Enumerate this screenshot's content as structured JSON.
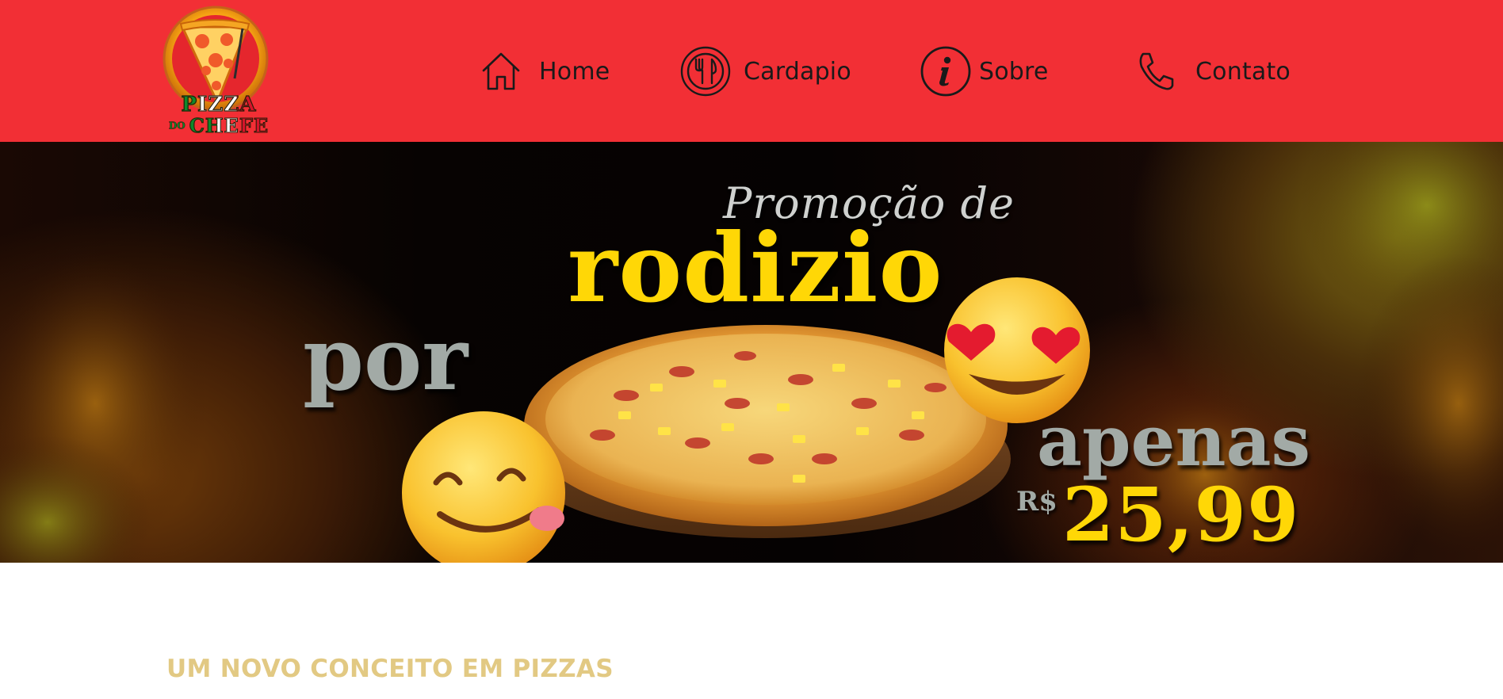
{
  "colors": {
    "brand": "#f22f35",
    "gold_heading": "#e2c983",
    "promo_yellow": "#ffd706",
    "promo_gray": "#a2aaa6"
  },
  "logo": {
    "text_line1": "PIZZA",
    "text_line2_small": "DO",
    "text_line2": "CHEFE"
  },
  "nav": [
    {
      "label": "Home",
      "icon": "home-icon"
    },
    {
      "label": "Cardapio",
      "icon": "fork-knife-icon"
    },
    {
      "label": "Sobre",
      "icon": "info-icon"
    },
    {
      "label": "Contato",
      "icon": "phone-icon"
    }
  ],
  "banner": {
    "line1": "Promoção de",
    "line2": "rodizio",
    "line3": "por",
    "line4": "apenas",
    "currency": "R$",
    "price": "25,99",
    "images": [
      "pizza",
      "heart-eyes-emoji",
      "yum-emoji"
    ]
  },
  "section": {
    "title": "UM NOVO CONCEITO EM PIZZAS"
  }
}
